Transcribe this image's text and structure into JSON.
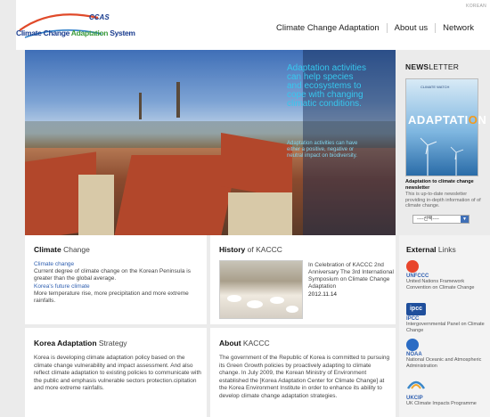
{
  "header": {
    "lang": "KOREAN",
    "logo": {
      "ccas": "CCAS",
      "part1": "Climate Change ",
      "part2": "Adaptation",
      "part3": " System"
    },
    "nav": [
      "Climate Change Adaptation",
      "About us",
      "Network"
    ]
  },
  "hero": {
    "title": "Adaptation activities can help species and ecosystems to cope with changing climatic conditions.",
    "subtitle": "Adaptation activities can have either a positive, negative or neutral impact on biodiversity."
  },
  "newsletter": {
    "title_bold": "NEWS",
    "title_rest": "LETTER",
    "cover_tag": "CLIMATE WATCH",
    "cover_word_a": "ADAPTATI",
    "cover_word_o": "O",
    "cover_word_b": "N",
    "caption": "Adaptation to climate change newsletter",
    "desc": "This is up-to-date newsletter providing in-depth information of of climate change.",
    "select_value": "----선택----"
  },
  "climate_change": {
    "title_bold": "Climate",
    "title_rest": " Change",
    "link1": "Climate change",
    "desc1": "Current degree of climate change on the Korean Peninsula is greater than the global average.",
    "link2": "Korea's future climate",
    "desc2": "More temperature rise, more precipitation and more extreme rainfalls."
  },
  "history": {
    "title_bold": "History",
    "title_rest": " of KACCC",
    "text": "In Celebration of KACCC 2nd Anniversary The 3rd International Symposium on Climate Change Adaptation",
    "date": "2012.11.14"
  },
  "korea_adaptation": {
    "title_bold": "Korea Adaptation",
    "title_rest": " Strategy",
    "text": "Korea is developing climate adaptation policy based on the climate change vulnerability and impact assessment. And also reflect climate adaptation to existing policies to communicate with the public and emphasis vulnerable sectors protection.cipitation and more extreme rainfalls."
  },
  "about": {
    "title_bold": "About",
    "title_rest": " KACCC",
    "text": "The government of the Republic of Korea is committed to pursuing its Green Growth policies by proactively adapting to climate change. In July 2009, the Korean Ministry of Environment established the [Korea Adaptation Center for Climate Change] at the Korea Environment Institute in order to enhance its ability to develop climate change adaptation strategies."
  },
  "external": {
    "title_bold": "External",
    "title_rest": " Links",
    "items": [
      {
        "name": "UNFCCC",
        "desc": "United Nations Framework Convention on Climate Change",
        "color": "#e8452c",
        "icon": "unfccc-logo-icon"
      },
      {
        "name": "IPCC",
        "desc": "Intergovernmental Panel on Climate Change",
        "color": "#1f4f9c",
        "icon": "ipcc-logo-icon"
      },
      {
        "name": "NOAA",
        "desc": "National Oceanic and Atmospheric Administration",
        "color": "#2b6cc4",
        "icon": "noaa-logo-icon"
      },
      {
        "name": "UKCIP",
        "desc": "UK Climate Impacts Programme",
        "color": "#3a87c8",
        "icon": "ukcip-logo-icon"
      }
    ]
  }
}
